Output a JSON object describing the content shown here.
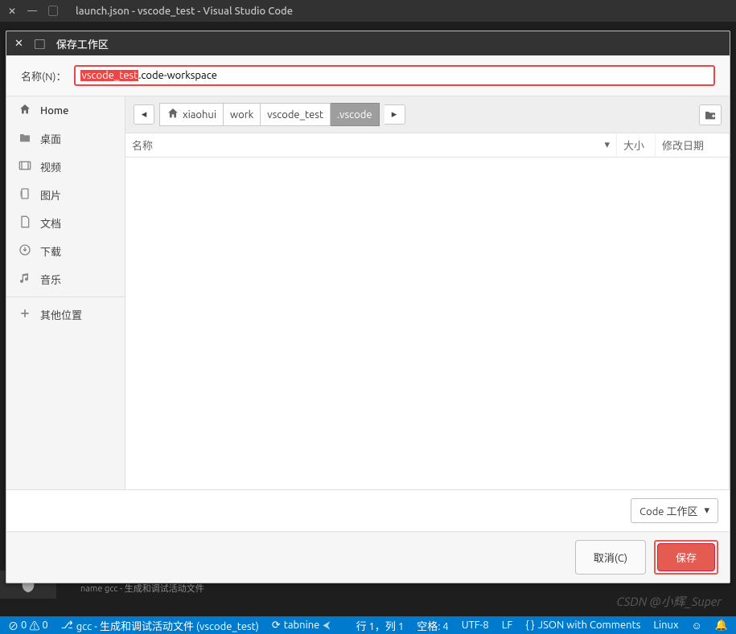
{
  "titlebar": {
    "title": "launch.json - vscode_test - Visual Studio Code"
  },
  "dialog": {
    "title": "保存工作区",
    "name_label": "名称(N)：",
    "filename_selected": "vscode_test",
    "filename_rest": ".code-workspace",
    "sidebar": [
      {
        "icon": "home-icon",
        "label": "Home",
        "cls": "home"
      },
      {
        "icon": "folder-icon",
        "label": "桌面"
      },
      {
        "icon": "video-icon",
        "label": "视频"
      },
      {
        "icon": "image-icon",
        "label": "图片"
      },
      {
        "icon": "document-icon",
        "label": "文档"
      },
      {
        "icon": "download-icon",
        "label": "下载"
      },
      {
        "icon": "music-icon",
        "label": "音乐"
      },
      {
        "icon": "plus-icon",
        "label": "其他位置",
        "sep": true
      }
    ],
    "path": [
      "xiaohui",
      "work",
      "vscode_test",
      ".vscode"
    ],
    "columns": {
      "name": "名称",
      "size": "大小",
      "date": "修改日期"
    },
    "filter": "Code 工作区",
    "cancel": "取消(C)",
    "save": "保存"
  },
  "behind_text": "name   gcc - 生成和调试活动文件",
  "status": {
    "errors": "0",
    "warnings": "0",
    "build": "gcc - 生成和调试活动文件 (vscode_test)",
    "tabnine": "tabnine",
    "pos": "行 1，列 1",
    "spaces": "空格: 4",
    "encoding": "UTF-8",
    "eol": "LF",
    "lang": "JSON with Comments",
    "os": "Linux"
  },
  "watermark": "CSDN @小辉_Super"
}
